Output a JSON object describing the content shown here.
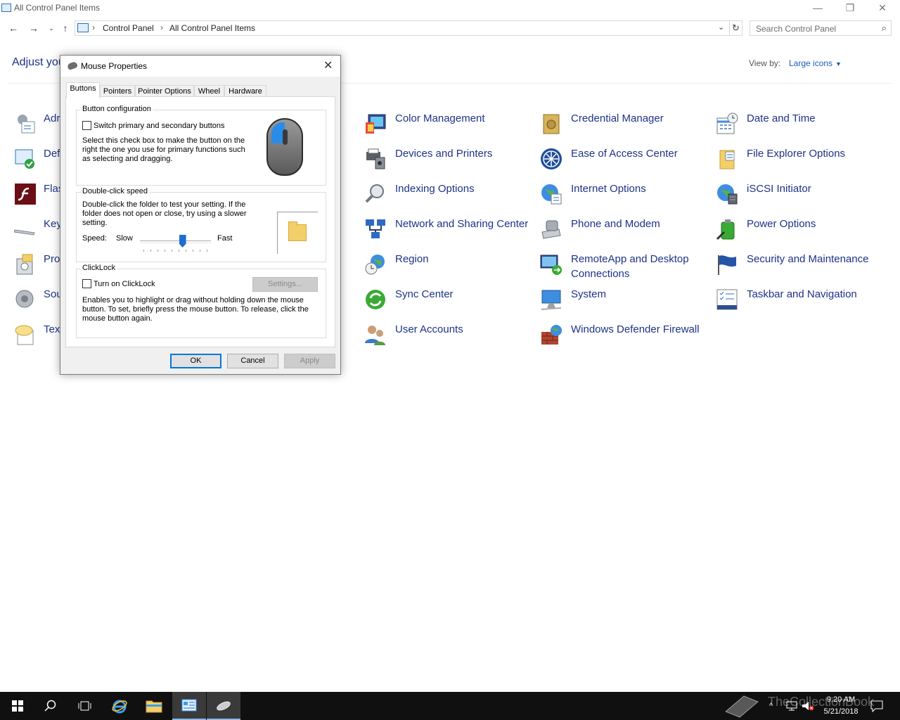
{
  "window": {
    "title": "All Control Panel Items",
    "minimize_glyph": "—",
    "restore_glyph": "❐",
    "close_glyph": "✕"
  },
  "address": {
    "crumbs": [
      "Control Panel",
      "All Control Panel Items"
    ],
    "separator": "›",
    "search_placeholder": "Search Control Panel"
  },
  "header": {
    "adjust_text": "Adjust you",
    "view_by_label": "View by:",
    "view_by_value": "Large icons"
  },
  "items": {
    "left_partial": [
      "Adr",
      "Def",
      "Flas",
      "Key",
      "Pro",
      "Sou",
      "Text"
    ],
    "col2": [
      "Color Management",
      "Devices and Printers",
      "Indexing Options",
      "Network and Sharing Center",
      "Region",
      "Sync Center",
      "User Accounts"
    ],
    "col3": [
      "Credential Manager",
      "Ease of Access Center",
      "Internet Options",
      "Phone and Modem",
      "RemoteApp and Desktop Connections",
      "System",
      "Windows Defender Firewall"
    ],
    "col4": [
      "Date and Time",
      "File Explorer Options",
      "iSCSI Initiator",
      "Power Options",
      "Security and Maintenance",
      "Taskbar and Navigation"
    ]
  },
  "dialog": {
    "title": "Mouse Properties",
    "tabs": [
      "Buttons",
      "Pointers",
      "Pointer Options",
      "Wheel",
      "Hardware"
    ],
    "button_config": {
      "legend": "Button configuration",
      "checkbox_label": "Switch primary and secondary buttons",
      "checked": false,
      "description": "Select this check box to make the button on the right the one you use for primary functions such as selecting and dragging."
    },
    "double_click": {
      "legend": "Double-click speed",
      "description": "Double-click the folder to test your setting. If the folder does not open or close, try using a slower setting.",
      "speed_label": "Speed:",
      "slow_label": "Slow",
      "fast_label": "Fast",
      "speed_fraction": 0.6
    },
    "clicklock": {
      "legend": "ClickLock",
      "checkbox_label": "Turn on ClickLock",
      "checked": false,
      "settings_button": "Settings...",
      "description": "Enables you to highlight or drag without holding down the mouse button. To set, briefly press the mouse button. To release, click the mouse button again."
    },
    "buttons": {
      "ok": "OK",
      "cancel": "Cancel",
      "apply": "Apply"
    }
  },
  "taskbar": {
    "time": "9:20 AM",
    "date": "5/21/2018",
    "watermark": "TheCollectionBook"
  }
}
